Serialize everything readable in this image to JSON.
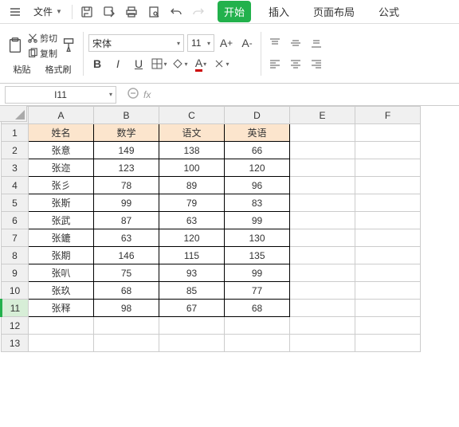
{
  "menu": {
    "file": "文件"
  },
  "tabs": {
    "start": "开始",
    "insert": "插入",
    "layout": "页面布局",
    "formula": "公式"
  },
  "ribbon": {
    "paste": "粘贴",
    "cut": "剪切",
    "copy": "复制",
    "format_painter": "格式刷",
    "font_name": "宋体",
    "font_size": "11"
  },
  "namebox": "I11",
  "fx_label": "fx",
  "columns": [
    "A",
    "B",
    "C",
    "D",
    "E",
    "F"
  ],
  "rows": [
    "1",
    "2",
    "3",
    "4",
    "5",
    "6",
    "7",
    "8",
    "9",
    "10",
    "11",
    "12",
    "13"
  ],
  "selected_row": 11,
  "chart_data": {
    "type": "table",
    "headers": [
      "姓名",
      "数学",
      "语文",
      "英语"
    ],
    "rows": [
      [
        "张意",
        149,
        138,
        66
      ],
      [
        "张迩",
        123,
        100,
        120
      ],
      [
        "张彡",
        78,
        89,
        96
      ],
      [
        "张斯",
        99,
        79,
        83
      ],
      [
        "张武",
        87,
        63,
        99
      ],
      [
        "张鏕",
        63,
        120,
        130
      ],
      [
        "张期",
        146,
        115,
        135
      ],
      [
        "张叭",
        75,
        93,
        99
      ],
      [
        "张玖",
        68,
        85,
        77
      ],
      [
        "张释",
        98,
        67,
        68
      ]
    ]
  }
}
